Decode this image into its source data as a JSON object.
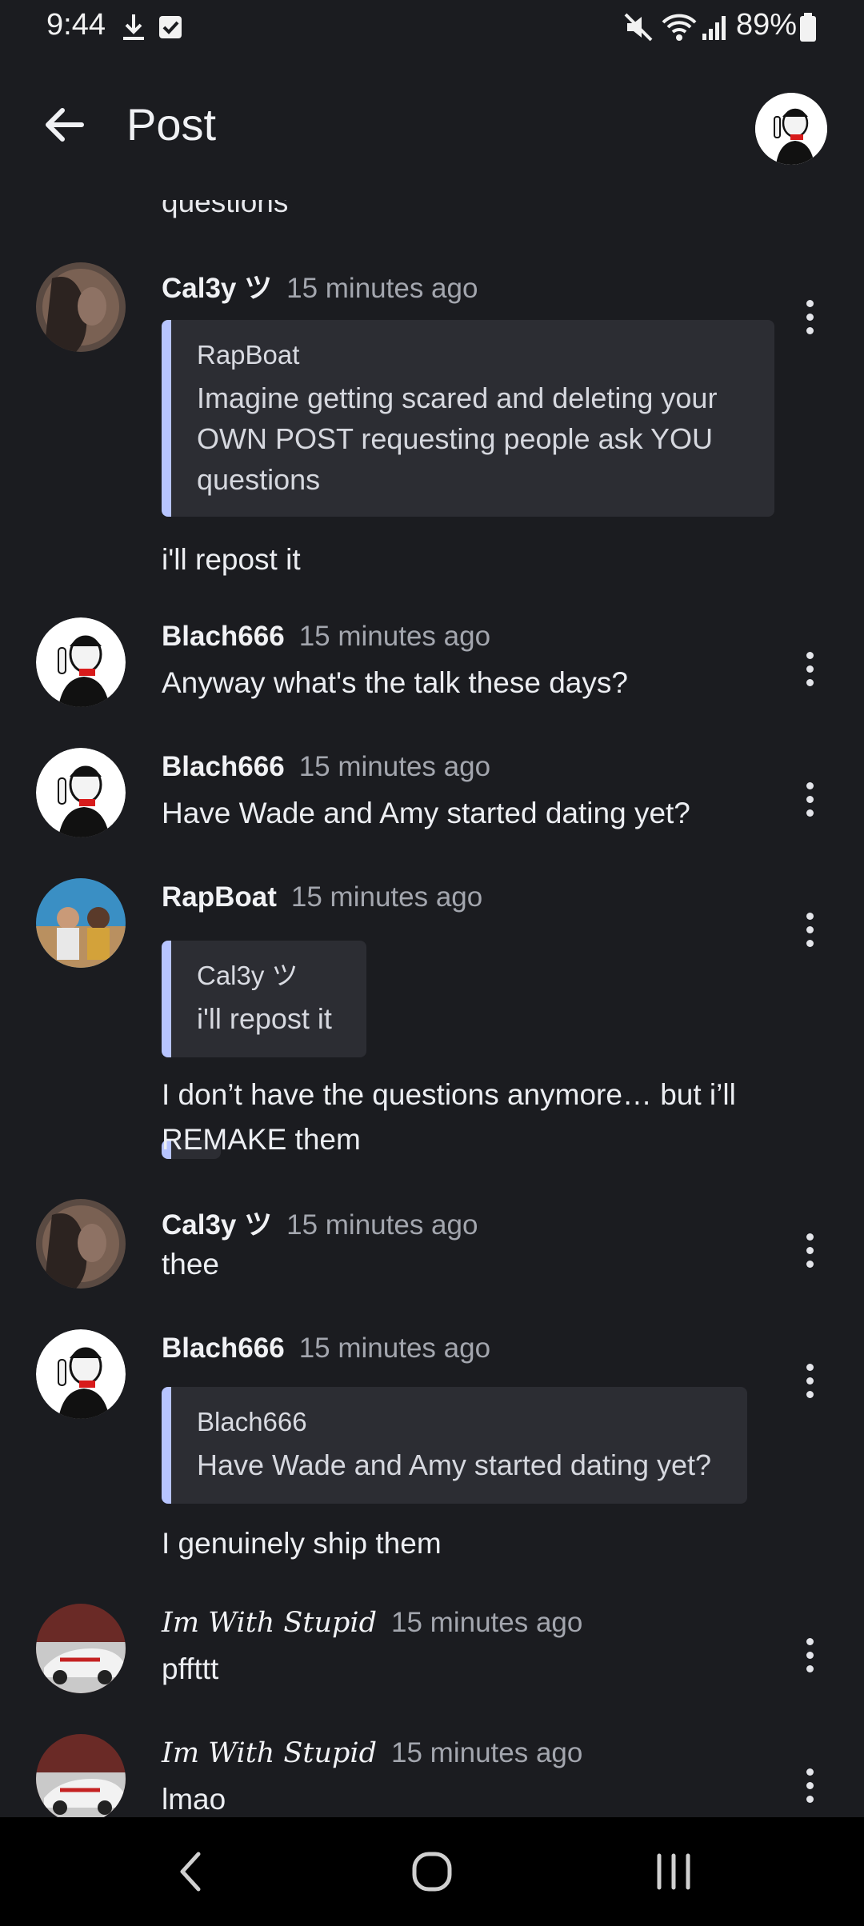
{
  "status_bar": {
    "time": "9:44",
    "battery": "89%"
  },
  "header": {
    "title": "Post"
  },
  "feed": {
    "truncated_text": "questions",
    "comments": [
      {
        "user": "Cal3y ツ",
        "time": "15 minutes ago",
        "quote": {
          "user": "RapBoat",
          "text": "Imagine getting scared and deleting your OWN POST requesting people ask YOU questions"
        },
        "text": "i'll repost it"
      },
      {
        "user": "Blach666",
        "time": "15 minutes ago",
        "text": "Anyway what's the talk these days?"
      },
      {
        "user": "Blach666",
        "time": "15 minutes ago",
        "text": "Have Wade and Amy started dating yet?"
      },
      {
        "user": "RapBoat",
        "time": "15 minutes ago",
        "quote": {
          "user": "Cal3y ツ",
          "text": "i'll repost it"
        },
        "text": "I don’t have the questions anymore… but i’ll REMAKE them"
      },
      {
        "user": "Cal3y ツ",
        "time": "15 minutes ago",
        "text": "thee"
      },
      {
        "user": "Blach666",
        "time": "15 minutes ago",
        "quote": {
          "user": "Blach666",
          "text": "Have Wade and Amy started dating yet?"
        },
        "text": "I genuinely ship them"
      },
      {
        "user": "Im With Stupid",
        "time": "15 minutes ago",
        "text": "pffttt"
      },
      {
        "user": "Im With Stupid",
        "time": "15 minutes ago",
        "text": "lmao"
      }
    ]
  },
  "icons": {
    "back": "arrow-left-icon",
    "more": "more-vertical-icon",
    "nav_back": "chevron-left-icon",
    "nav_home": "home-circle-icon",
    "nav_recents": "recents-icon"
  },
  "colors": {
    "background": "#1b1c20",
    "quote_bar": "#b7c4ff",
    "quote_bg": "#2c2d33",
    "muted": "#a3a6ae"
  }
}
